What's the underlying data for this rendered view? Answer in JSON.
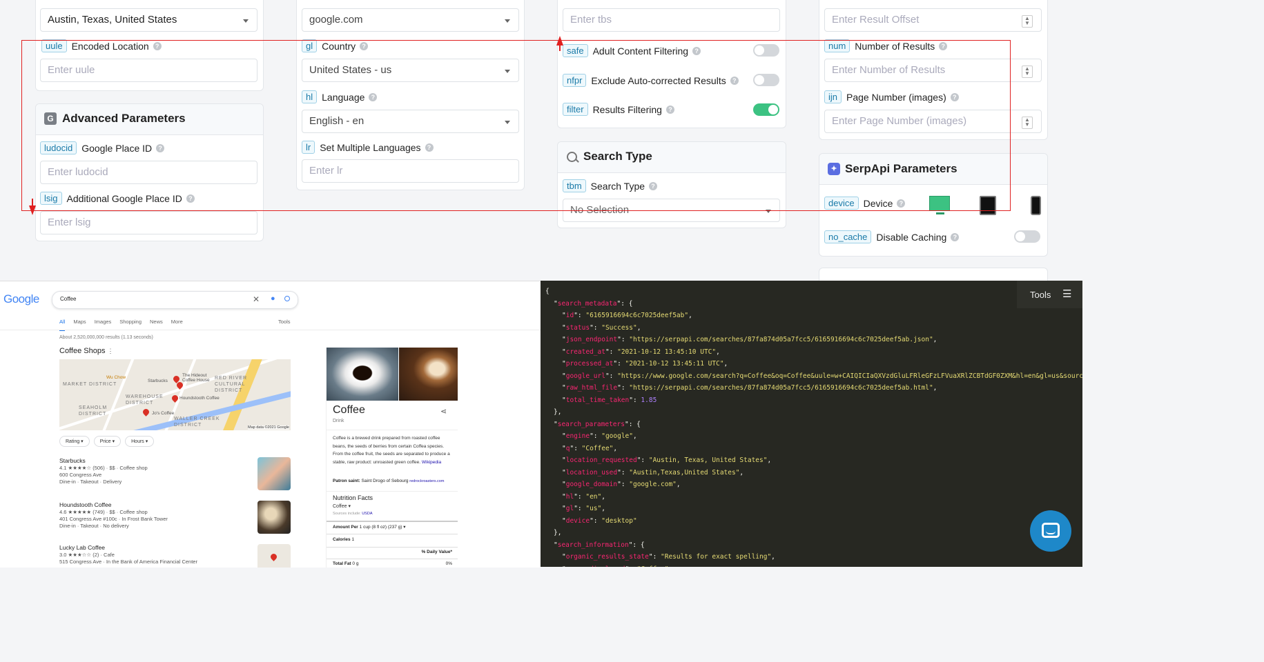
{
  "col1": {
    "location_value": "Austin, Texas, United States",
    "uule": {
      "tag": "uule",
      "label": "Encoded Location",
      "placeholder": "Enter uule"
    },
    "advanced_title": "Advanced Parameters",
    "ludocid": {
      "tag": "ludocid",
      "label": "Google Place ID",
      "placeholder": "Enter ludocid"
    },
    "lsig": {
      "tag": "lsig",
      "label": "Additional Google Place ID",
      "placeholder": "Enter lsig"
    }
  },
  "col2": {
    "domain_value": "google.com",
    "gl": {
      "tag": "gl",
      "label": "Country",
      "value": "United States - us"
    },
    "hl": {
      "tag": "hl",
      "label": "Language",
      "value": "English - en"
    },
    "lr": {
      "tag": "lr",
      "label": "Set Multiple Languages",
      "placeholder": "Enter lr"
    }
  },
  "col3": {
    "tbs_placeholder": "Enter tbs",
    "safe": {
      "tag": "safe",
      "label": "Adult Content Filtering",
      "on": false
    },
    "nfpr": {
      "tag": "nfpr",
      "label": "Exclude Auto-corrected Results",
      "on": false
    },
    "filter": {
      "tag": "filter",
      "label": "Results Filtering",
      "on": true
    },
    "search_type_title": "Search Type",
    "tbm": {
      "tag": "tbm",
      "label": "Search Type",
      "value": "No Selection"
    }
  },
  "col4": {
    "offset_placeholder": "Enter Result Offset",
    "num": {
      "tag": "num",
      "label": "Number of Results",
      "placeholder": "Enter Number of Results"
    },
    "ijn": {
      "tag": "ijn",
      "label": "Page Number (images)",
      "placeholder": "Enter Page Number (images)"
    },
    "serpapi_title": "SerpApi Parameters",
    "device": {
      "tag": "device",
      "label": "Device"
    },
    "no_cache": {
      "tag": "no_cache",
      "label": "Disable Caching",
      "on": false
    }
  },
  "google": {
    "logo": "Google",
    "query": "Coffee",
    "tabs": [
      "All",
      "Maps",
      "Images",
      "Shopping",
      "News",
      "More"
    ],
    "tools": "Tools",
    "stats": "About 2,520,000,000 results (1.13 seconds)",
    "local_title": "Coffee Shops",
    "map_credit": "Map data ©2021 Google",
    "map_labels": [
      "Wu Chow",
      "Starbucks",
      "The Hideout Coffee House",
      "RED RIVER CULTURAL DISTRICT",
      "MARKET DISTRICT",
      "WAREHOUSE DISTRICT",
      "Houndstooth Coffee",
      "SEAHOLM DISTRICT",
      "Jo's Coffee",
      "WALLER CREEK DISTRICT"
    ],
    "filters": [
      "Rating",
      "Price",
      "Hours"
    ],
    "places": [
      {
        "name": "Starbucks",
        "line1": "4.1 ★★★★☆ (506) · $$ · Coffee shop",
        "line2": "600 Congress Ave",
        "line3": "Dine-in · Takeout · Delivery"
      },
      {
        "name": "Houndstooth Coffee",
        "line1": "4.6 ★★★★★ (749) · $$ · Coffee shop",
        "line2": "401 Congress Ave #100c · In Frost Bank Tower",
        "line3": "Dine-in · Takeout · No delivery"
      },
      {
        "name": "Lucky Lab Coffee",
        "line1": "3.0 ★★★☆☆ (2) · Cafe",
        "line2": "515 Congress Ave · In the Bank of America Financial Center",
        "line3": ""
      }
    ],
    "kp_title": "Coffee",
    "kp_subtitle": "Drink",
    "kp_desc": "Coffee is a brewed drink prepared from roasted coffee beans, the seeds of berries from certain Coffea species. From the coffee fruit, the seeds are separated to produce a stable, raw product: unroasted green coffee.",
    "kp_wiki": "Wikipedia",
    "kp_patron_label": "Patron saint:",
    "kp_patron": "Saint Drogo of Sebourg",
    "kp_patron_src": "redrockroasters.com",
    "nutrition_title": "Nutrition Facts",
    "nutrition_item": "Coffee",
    "sources": "Sources include:",
    "sources_link": "USDA",
    "amount_label": "Amount Per",
    "amount_value": "1 cup (8 fl oz) (237 g)",
    "calories_label": "Calories",
    "calories_value": "1",
    "daily_value": "% Daily Value*",
    "fat_label": "Total Fat",
    "fat_value": "0 g",
    "fat_pct": "0%"
  },
  "json_panel": {
    "tools_label": "Tools",
    "lines": [
      {
        "indent": 0,
        "text": "{"
      },
      {
        "indent": 1,
        "key": "search_metadata",
        "raw": "{"
      },
      {
        "indent": 2,
        "key": "id",
        "str": "6165916694c6c7025deef5ab"
      },
      {
        "indent": 2,
        "key": "status",
        "str": "Success"
      },
      {
        "indent": 2,
        "key": "json_endpoint",
        "str": "https://serpapi.com/searches/87fa874d05a7fcc5/6165916694c6c7025deef5ab.json"
      },
      {
        "indent": 2,
        "key": "created_at",
        "str": "2021-10-12 13:45:10 UTC"
      },
      {
        "indent": 2,
        "key": "processed_at",
        "str": "2021-10-12 13:45:11 UTC"
      },
      {
        "indent": 2,
        "key": "google_url",
        "str": "https://www.google.com/search?q=Coffee&oq=Coffee&uule=w+CAIQICIaQXVzdGluLFRleGFzLFVuaXRlZCBTdGF0ZXM&hl=en&gl=us&sourceid=chrome&ie=U"
      },
      {
        "indent": 2,
        "key": "raw_html_file",
        "str": "https://serpapi.com/searches/87fa874d05a7fcc5/6165916694c6c7025deef5ab.html"
      },
      {
        "indent": 2,
        "key": "total_time_taken",
        "num": "1.85"
      },
      {
        "indent": 1,
        "text": "},"
      },
      {
        "indent": 1,
        "key": "search_parameters",
        "raw": "{"
      },
      {
        "indent": 2,
        "key": "engine",
        "str": "google"
      },
      {
        "indent": 2,
        "key": "q",
        "str": "Coffee"
      },
      {
        "indent": 2,
        "key": "location_requested",
        "str": "Austin, Texas, United States"
      },
      {
        "indent": 2,
        "key": "location_used",
        "str": "Austin,Texas,United States"
      },
      {
        "indent": 2,
        "key": "google_domain",
        "str": "google.com"
      },
      {
        "indent": 2,
        "key": "hl",
        "str": "en"
      },
      {
        "indent": 2,
        "key": "gl",
        "str": "us"
      },
      {
        "indent": 2,
        "key": "device",
        "str": "desktop",
        "last": true
      },
      {
        "indent": 1,
        "text": "},"
      },
      {
        "indent": 1,
        "key": "search_information",
        "raw": "{"
      },
      {
        "indent": 2,
        "key": "organic_results_state",
        "str": "Results for exact spelling"
      },
      {
        "indent": 2,
        "key": "query_displayed",
        "str": "Coffee"
      }
    ]
  },
  "colors": {
    "accent": "#1a7aa8",
    "toggle_on": "#3cc282",
    "annotation": "#e02020",
    "chat": "#1e88c9"
  }
}
